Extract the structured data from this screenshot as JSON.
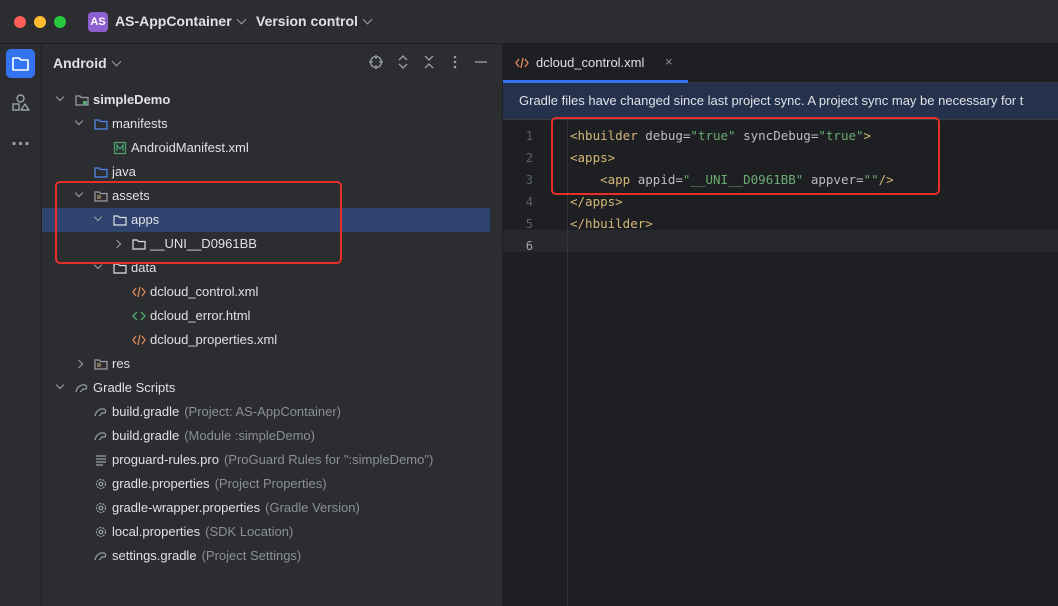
{
  "titlebar": {
    "project_badge": "AS",
    "project_name": "AS-AppContainer",
    "version_control": "Version control"
  },
  "colors": {
    "accent": "#3574f0",
    "annotation": "#e5302a",
    "tag": "#d5b778",
    "string": "#6aab73",
    "banner": "#25324d"
  },
  "toolstrip": {
    "items": [
      "folder-icon",
      "shapes-icon",
      "more-icon"
    ]
  },
  "project_panel": {
    "title": "Android",
    "tools": [
      "target-icon",
      "expand-icon",
      "collapse-icon",
      "more-vertical-icon",
      "minimize-icon"
    ],
    "tree": [
      {
        "label": "simpleDemo",
        "hint": "",
        "bold": true
      },
      {
        "label": "manifests",
        "hint": ""
      },
      {
        "label": "AndroidManifest.xml",
        "hint": ""
      },
      {
        "label": "java",
        "hint": ""
      },
      {
        "label": "assets",
        "hint": ""
      },
      {
        "label": "apps",
        "hint": ""
      },
      {
        "label": "__UNI__D0961BB",
        "hint": ""
      },
      {
        "label": "data",
        "hint": ""
      },
      {
        "label": "dcloud_control.xml",
        "hint": ""
      },
      {
        "label": "dcloud_error.html",
        "hint": ""
      },
      {
        "label": "dcloud_properties.xml",
        "hint": ""
      },
      {
        "label": "res",
        "hint": ""
      },
      {
        "label": "Gradle Scripts",
        "hint": ""
      },
      {
        "label": "build.gradle",
        "hint": "(Project: AS-AppContainer)"
      },
      {
        "label": "build.gradle",
        "hint": "(Module :simpleDemo)"
      },
      {
        "label": "proguard-rules.pro",
        "hint": "(ProGuard Rules for \":simpleDemo\")"
      },
      {
        "label": "gradle.properties",
        "hint": "(Project Properties)"
      },
      {
        "label": "gradle-wrapper.properties",
        "hint": "(Gradle Version)"
      },
      {
        "label": "local.properties",
        "hint": "(SDK Location)"
      },
      {
        "label": "settings.gradle",
        "hint": "(Project Settings)"
      }
    ]
  },
  "editor": {
    "tab_label": "dcloud_control.xml",
    "tab_close": "×",
    "banner": "Gradle files have changed since last project sync. A project sync may be necessary for t",
    "line_numbers": [
      "1",
      "2",
      "3",
      "4",
      "5",
      "6"
    ],
    "lines": [
      [
        {
          "t": "tag",
          "v": "<hbuilder "
        },
        {
          "t": "attr",
          "v": "debug="
        },
        {
          "t": "val",
          "v": "\"true\""
        },
        {
          "t": "attr",
          "v": " syncDebug="
        },
        {
          "t": "val",
          "v": "\"true\""
        },
        {
          "t": "tag",
          "v": ">"
        }
      ],
      [
        {
          "t": "tag",
          "v": "<apps>"
        }
      ],
      [
        {
          "t": "attr",
          "v": "    "
        },
        {
          "t": "tag",
          "v": "<app "
        },
        {
          "t": "attr",
          "v": "appid="
        },
        {
          "t": "val",
          "v": "\"__UNI__D0961BB\""
        },
        {
          "t": "attr",
          "v": " appver="
        },
        {
          "t": "val",
          "v": "\"\""
        },
        {
          "t": "tag",
          "v": "/>"
        }
      ],
      [
        {
          "t": "tag",
          "v": "</apps>"
        }
      ],
      [
        {
          "t": "tag",
          "v": "</hbuilder>"
        }
      ],
      []
    ]
  }
}
